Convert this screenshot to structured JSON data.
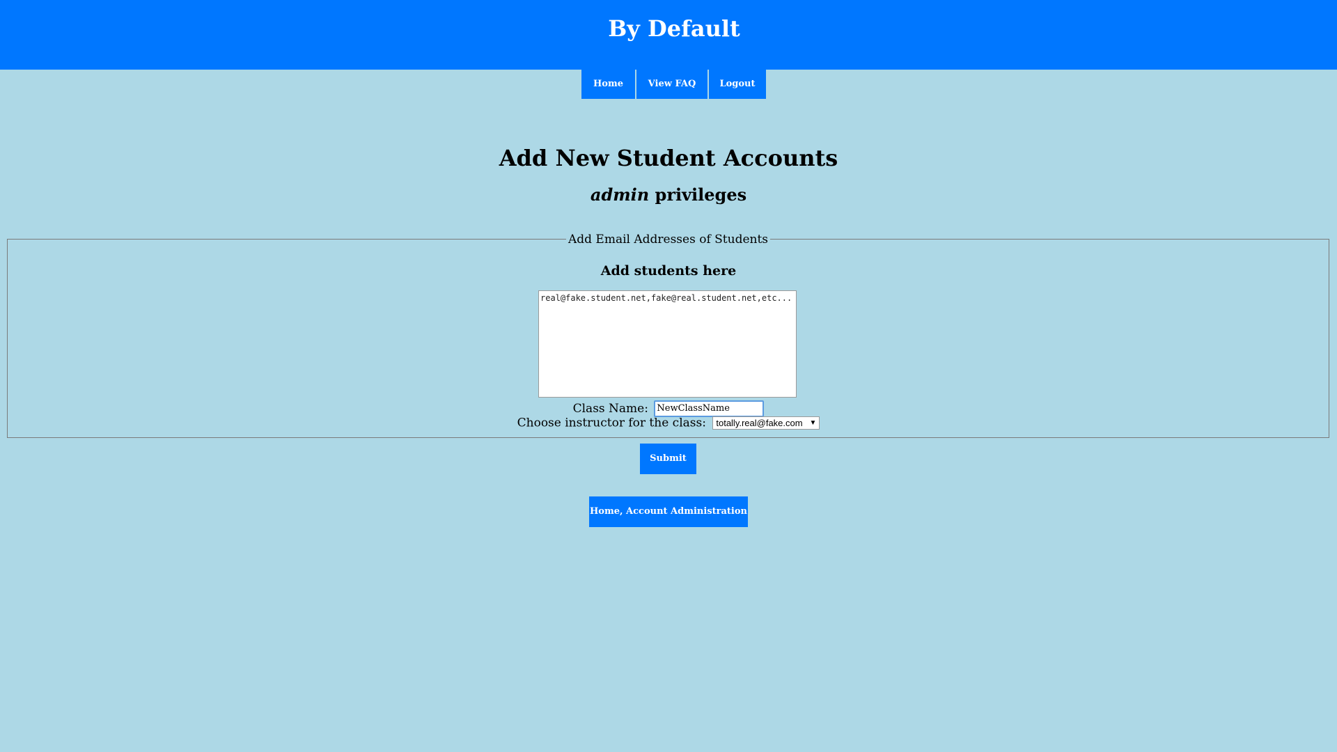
{
  "header": {
    "title": "By Default",
    "bg_color": "#0077ff"
  },
  "nav": {
    "items": [
      {
        "label": "Home"
      },
      {
        "label": "View FAQ"
      },
      {
        "label": "Logout"
      }
    ]
  },
  "page": {
    "title": "Add New Student Accounts",
    "subtitle_role": "admin",
    "subtitle_suffix": " privileges",
    "bg_color": "#add8e6"
  },
  "form": {
    "legend": "Add Email Addresses of Students",
    "section_title": "Add students here",
    "emails_value": "real@fake.student.net,fake@real.student.net,etc...",
    "class_name_label": "Class Name:",
    "class_name_value": "NewClassName",
    "instructor_label": "Choose instructor for the class:",
    "instructor_selected": "totally.real@fake.com",
    "submit_label": "Submit"
  },
  "footer": {
    "home_admin_label": "Home, Account Administration"
  },
  "icons": {
    "select_arrow": "chevron-down-icon"
  }
}
